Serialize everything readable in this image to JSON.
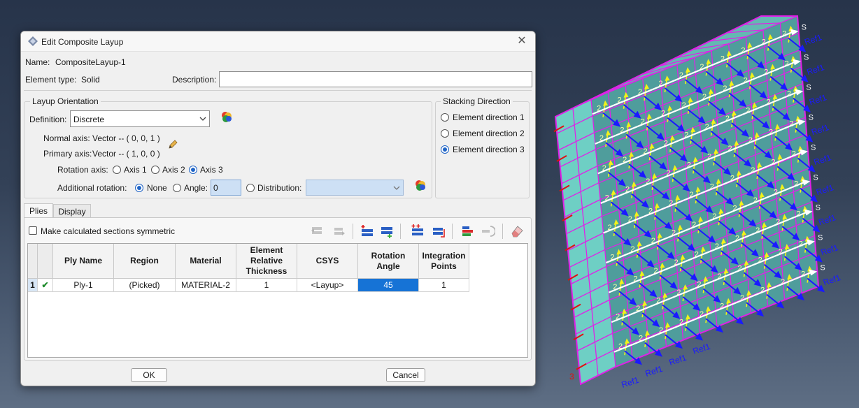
{
  "dialog": {
    "title": "Edit Composite Layup",
    "close_glyph": "✕",
    "name_label": "Name:",
    "name_value": "CompositeLayup-1",
    "element_type_label": "Element type:",
    "element_type_value": "Solid",
    "description_label": "Description:",
    "description_value": ""
  },
  "layup_orientation": {
    "title": "Layup Orientation",
    "definition_label": "Definition:",
    "definition_value": "Discrete",
    "normal_axis_label": "Normal axis:",
    "normal_axis_value": "Vector -- ( 0, 0, 1 )",
    "primary_axis_label": "Primary axis:",
    "primary_axis_value": "Vector -- ( 1, 0, 0 )",
    "rotation_axis_label": "Rotation axis:",
    "rotation_axis_options": [
      "Axis 1",
      "Axis 2",
      "Axis 3"
    ],
    "rotation_axis_selected": "Axis 3",
    "additional_rotation_label": "Additional rotation:",
    "none_label": "None",
    "angle_label": "Angle:",
    "angle_value": "0",
    "distribution_label": "Distribution:",
    "distribution_value": ""
  },
  "stacking_direction": {
    "title": "Stacking Direction",
    "options": [
      "Element direction 1",
      "Element direction 2",
      "Element direction 3"
    ],
    "selected": "Element direction 3"
  },
  "tabs": [
    {
      "label": "Plies",
      "active": true
    },
    {
      "label": "Display",
      "active": false
    }
  ],
  "symmetric_label": "Make calculated sections symmetric",
  "symmetric_checked": false,
  "table": {
    "headers": [
      "Ply Name",
      "Region",
      "Material",
      "Element Relative Thickness",
      "CSYS",
      "Rotation Angle",
      "Integration Points"
    ],
    "rows": [
      {
        "index": "1",
        "status": "✔",
        "cells": [
          "Ply-1",
          "(Picked)",
          "MATERIAL-2",
          "1",
          "<Layup>",
          "45",
          "1"
        ]
      }
    ]
  },
  "buttons": {
    "ok": "OK",
    "cancel": "Cancel"
  },
  "viewport": {
    "ref_label": "Ref1",
    "number_label": "2",
    "s_label": "S",
    "three_label": "3",
    "colors": {
      "face": "#6ecfc4",
      "mesh": "#e020e8",
      "arrow_yellow": "#f2f21a",
      "arrow_white": "#ffffff",
      "arrow_blue": "#1a1aff",
      "axis_red": "#e01010"
    }
  }
}
